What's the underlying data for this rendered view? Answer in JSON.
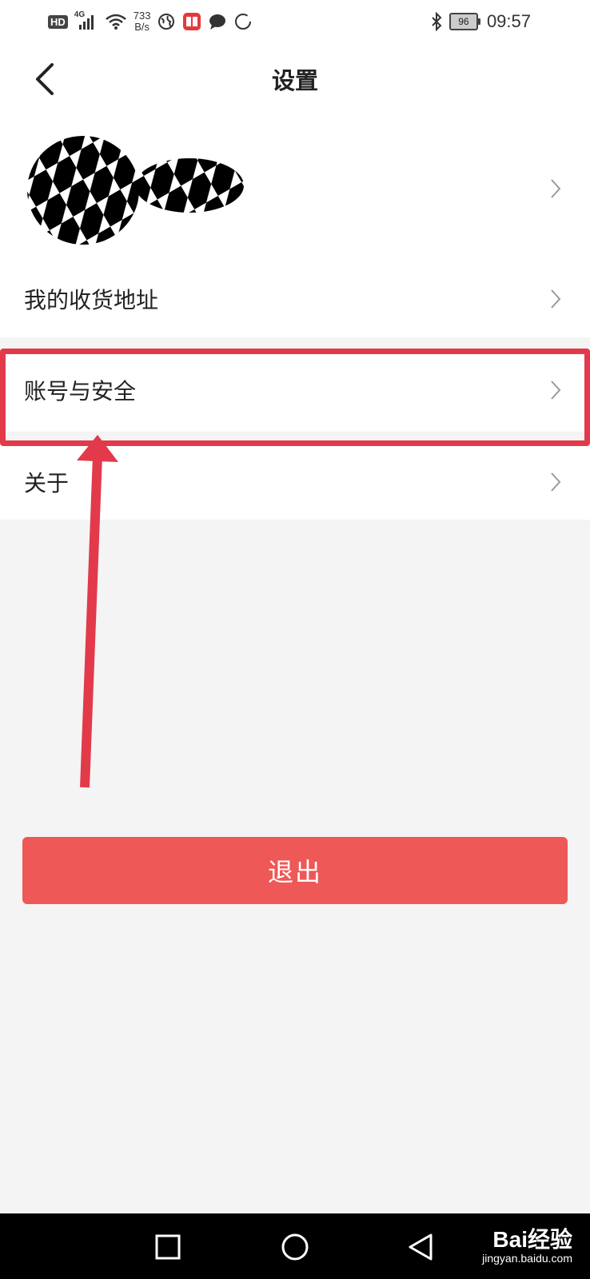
{
  "status_bar": {
    "hd": "HD",
    "network": "4G",
    "speed_value": "733",
    "speed_unit": "B/s",
    "battery": "96",
    "time": "09:57"
  },
  "header": {
    "title": "设置",
    "back_icon": "chevron-left-icon"
  },
  "menu": {
    "items": [
      {
        "label": "我的收货地址"
      },
      {
        "label": "账号与安全"
      },
      {
        "label": "关于"
      }
    ]
  },
  "logout_label": "退出",
  "annotation": {
    "color": "#e23a4a"
  },
  "watermark": {
    "brand": "Bai经验",
    "url": "jingyan.baidu.com"
  },
  "colors": {
    "accent": "#ee5857",
    "background": "#f4f4f4"
  }
}
